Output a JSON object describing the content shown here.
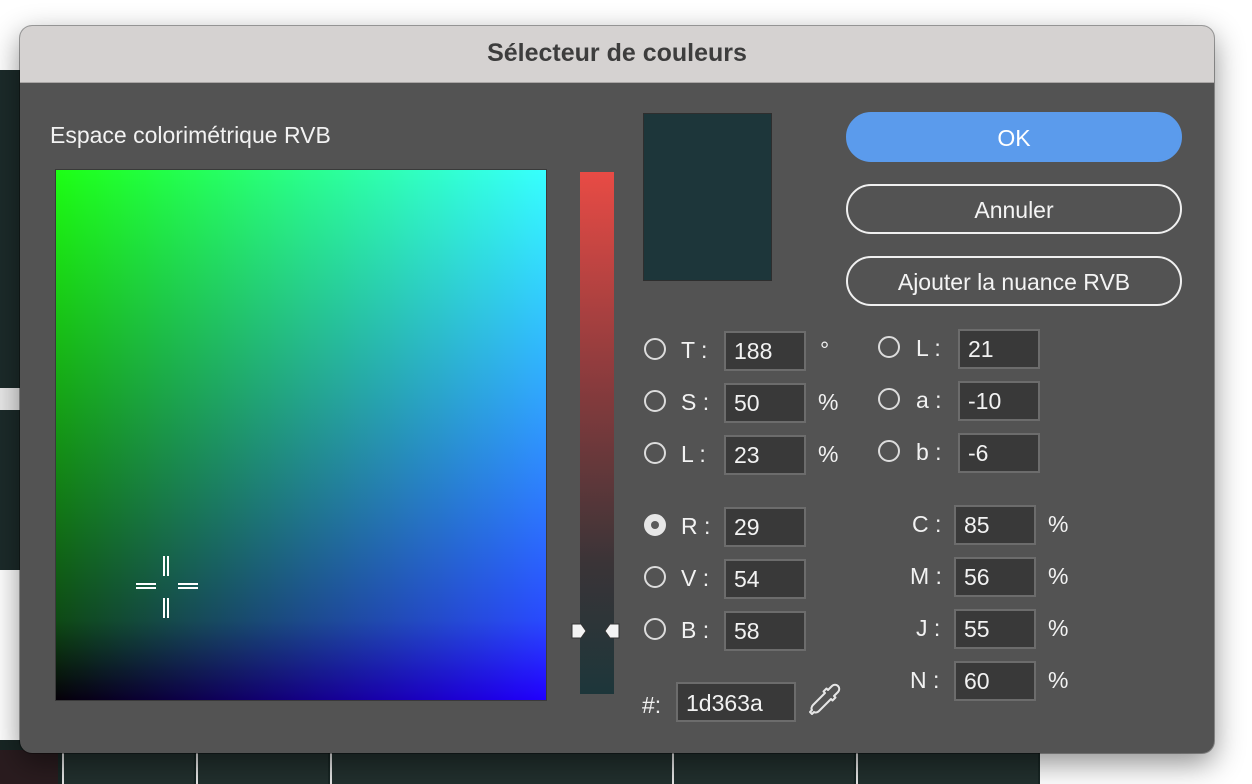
{
  "dialog": {
    "title": "Sélecteur de couleurs",
    "color_space_label": "Espace colorimétrique RVB"
  },
  "buttons": {
    "ok": "OK",
    "cancel": "Annuler",
    "add_swatch": "Ajouter la nuance RVB"
  },
  "hsb": [
    {
      "key": "h",
      "label": "T :",
      "value": "188",
      "unit": "°",
      "checked": false
    },
    {
      "key": "s",
      "label": "S :",
      "value": "50",
      "unit": "%",
      "checked": false
    },
    {
      "key": "l",
      "label": "L :",
      "value": "23",
      "unit": "%",
      "checked": false
    }
  ],
  "rgb": [
    {
      "key": "r",
      "label": "R :",
      "value": "29",
      "checked": true
    },
    {
      "key": "v",
      "label": "V :",
      "value": "54",
      "checked": false
    },
    {
      "key": "b",
      "label": "B :",
      "value": "58",
      "checked": false
    }
  ],
  "lab": [
    {
      "key": "l",
      "label": "L :",
      "value": "21",
      "checked": false
    },
    {
      "key": "a",
      "label": "a :",
      "value": "-10",
      "checked": false
    },
    {
      "key": "b",
      "label": "b :",
      "value": "-6",
      "checked": false
    }
  ],
  "cmyk": [
    {
      "key": "c",
      "label": "C :",
      "value": "85",
      "unit": "%"
    },
    {
      "key": "m",
      "label": "M :",
      "value": "56",
      "unit": "%"
    },
    {
      "key": "j",
      "label": "J :",
      "value": "55",
      "unit": "%"
    },
    {
      "key": "n",
      "label": "N :",
      "value": "60",
      "unit": "%"
    }
  ],
  "hex": {
    "label": "#:",
    "value": "1d363a"
  },
  "colors": {
    "current": "#1d363a",
    "accent": "#5b9bec",
    "dialog_bg": "#535353",
    "titlebar_bg": "#d5d2d1"
  },
  "icons": {
    "eyedropper": "eyedropper-icon",
    "crosshair": "crosshair-icon"
  }
}
